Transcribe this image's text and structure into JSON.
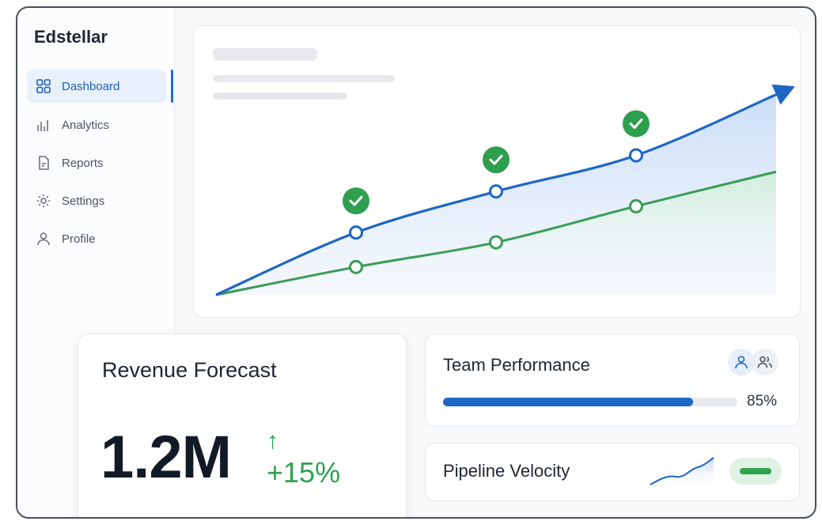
{
  "app": {
    "brand": "Edstellar"
  },
  "sidebar": {
    "items": [
      {
        "label": "Dashboard",
        "icon": "grid-icon",
        "active": true
      },
      {
        "label": "Analytics",
        "icon": "bar-chart-icon",
        "active": false
      },
      {
        "label": "Reports",
        "icon": "document-icon",
        "active": false
      },
      {
        "label": "Settings",
        "icon": "gear-icon",
        "active": false
      },
      {
        "label": "Profile",
        "icon": "user-icon",
        "active": false
      }
    ]
  },
  "chart_data": {
    "type": "area",
    "x": [
      0,
      1,
      2,
      3,
      4
    ],
    "series": [
      {
        "values": [
          0,
          38,
          63,
          85,
          122
        ],
        "color": "#1f66c4",
        "milestones": [
          1,
          2,
          3
        ]
      },
      {
        "values": [
          0,
          17,
          32,
          54,
          75
        ],
        "color": "#3a9c55"
      }
    ],
    "milestone_icon": "check-circle-icon",
    "trend_arrow": "arrow-up-right-icon",
    "grid": false,
    "legend": "none"
  },
  "revenue": {
    "title": "Revenue Forecast",
    "value": "1.2M",
    "arrow": "↑",
    "change": "+15%",
    "accent": "#2ea24f"
  },
  "team": {
    "title": "Team Performance",
    "progress": 0.85,
    "percent_label": "85%",
    "icons": [
      "user-icon",
      "users-icon"
    ],
    "accent": "#1f66c4"
  },
  "pipeline": {
    "title": "Pipeline Velocity",
    "sparkline_icon": "trend-line-icon",
    "status_icon": "status-pill-icon"
  }
}
